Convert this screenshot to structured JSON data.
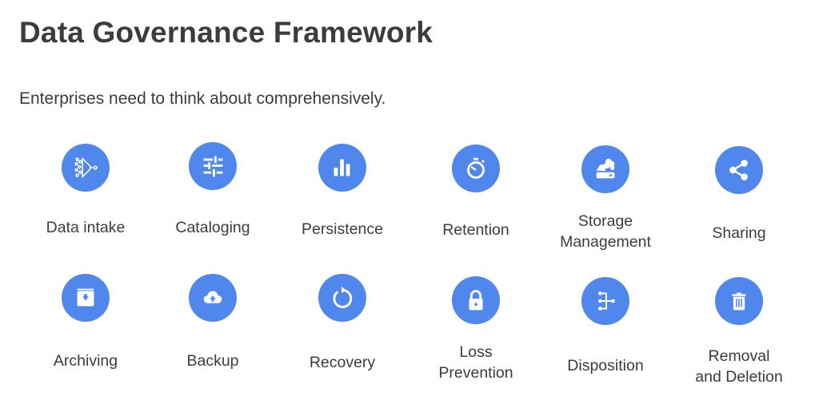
{
  "header": {
    "title": "Data Governance Framework",
    "subtitle": "Enterprises need to think about comprehensively."
  },
  "accent_color": "#5087ec",
  "items": [
    {
      "label": "Data intake",
      "icon": "funnel-icon"
    },
    {
      "label": "Cataloging",
      "icon": "sliders-icon"
    },
    {
      "label": "Persistence",
      "icon": "bar-chart-icon"
    },
    {
      "label": "Retention",
      "icon": "stopwatch-icon"
    },
    {
      "label": "Storage Management",
      "icon": "cloud-drive-icon"
    },
    {
      "label": "Sharing",
      "icon": "share-icon"
    },
    {
      "label": "Archiving",
      "icon": "archive-box-icon"
    },
    {
      "label": "Backup",
      "icon": "cloud-upload-icon"
    },
    {
      "label": "Recovery",
      "icon": "refresh-icon"
    },
    {
      "label": "Loss Prevention",
      "icon": "lock-icon"
    },
    {
      "label": "Disposition",
      "icon": "tree-branch-icon"
    },
    {
      "label": "Removal and Deletion",
      "icon": "trash-icon"
    }
  ]
}
